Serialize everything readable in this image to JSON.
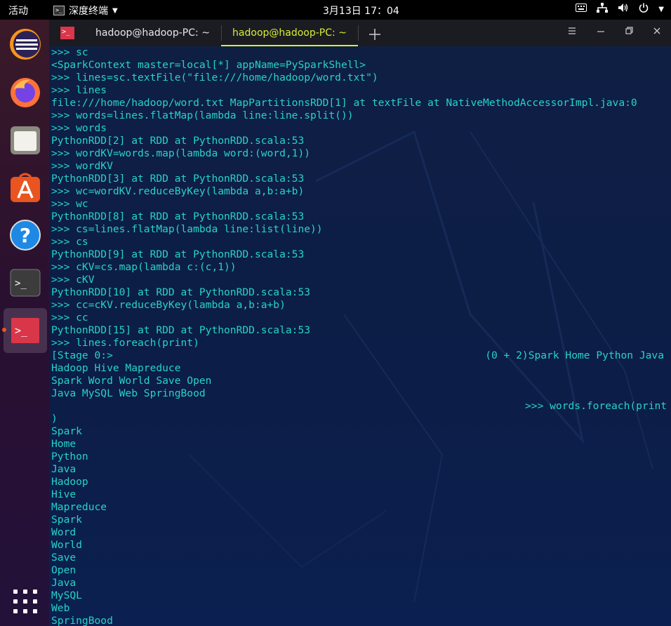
{
  "topbar": {
    "activities": "活动",
    "app_name": "深度终端",
    "clock": "3月13日 17：04"
  },
  "tabs": [
    {
      "label": "hadoop@hadoop-PC: ~"
    },
    {
      "label": "hadoop@hadoop-PC: ~"
    }
  ],
  "colors": {
    "terminal_text": "#27d3c7",
    "active_tab": "#d7ef34",
    "terminal_icon": "#d9364a"
  },
  "terminal": {
    "lines": [
      ">>> sc",
      "<SparkContext master=local[*] appName=PySparkShell>",
      ">>> lines=sc.textFile(\"file:///home/hadoop/word.txt\")",
      ">>> lines",
      "file:///home/hadoop/word.txt MapPartitionsRDD[1] at textFile at NativeMethodAccessorImpl.java:0",
      ">>> words=lines.flatMap(lambda line:line.split())",
      ">>> words",
      "PythonRDD[2] at RDD at PythonRDD.scala:53",
      ">>> wordKV=words.map(lambda word:(word,1))",
      ">>> wordKV",
      "PythonRDD[3] at RDD at PythonRDD.scala:53",
      ">>> wc=wordKV.reduceByKey(lambda a,b:a+b)",
      ">>> wc",
      "PythonRDD[8] at RDD at PythonRDD.scala:53",
      ">>> cs=lines.flatMap(lambda line:list(line))",
      ">>> cs",
      "PythonRDD[9] at RDD at PythonRDD.scala:53",
      ">>> cKV=cs.map(lambda c:(c,1))",
      ">>> cKV",
      "PythonRDD[10] at RDD at PythonRDD.scala:53",
      ">>> cc=cKV.reduceByKey(lambda a,b:a+b)",
      ">>> cc",
      "PythonRDD[15] at RDD at PythonRDD.scala:53",
      ">>> lines.foreach(print)"
    ],
    "stage_left": "[Stage 0:>",
    "stage_right": "(0 + 2)Spark Home Python Java",
    "after_stage": [
      "Hadoop Hive Mapreduce",
      "Spark Word World Save Open",
      "Java MySQL Web SpringBood"
    ],
    "indented_prompt": ">>> words.foreach(print",
    "tail": [
      ")",
      "Spark",
      "Home",
      "Python",
      "Java",
      "Hadoop",
      "Hive",
      "Mapreduce",
      "Spark",
      "Word",
      "World",
      "Save",
      "Open",
      "Java",
      "MySQL",
      "Web",
      "SpringBood"
    ]
  }
}
